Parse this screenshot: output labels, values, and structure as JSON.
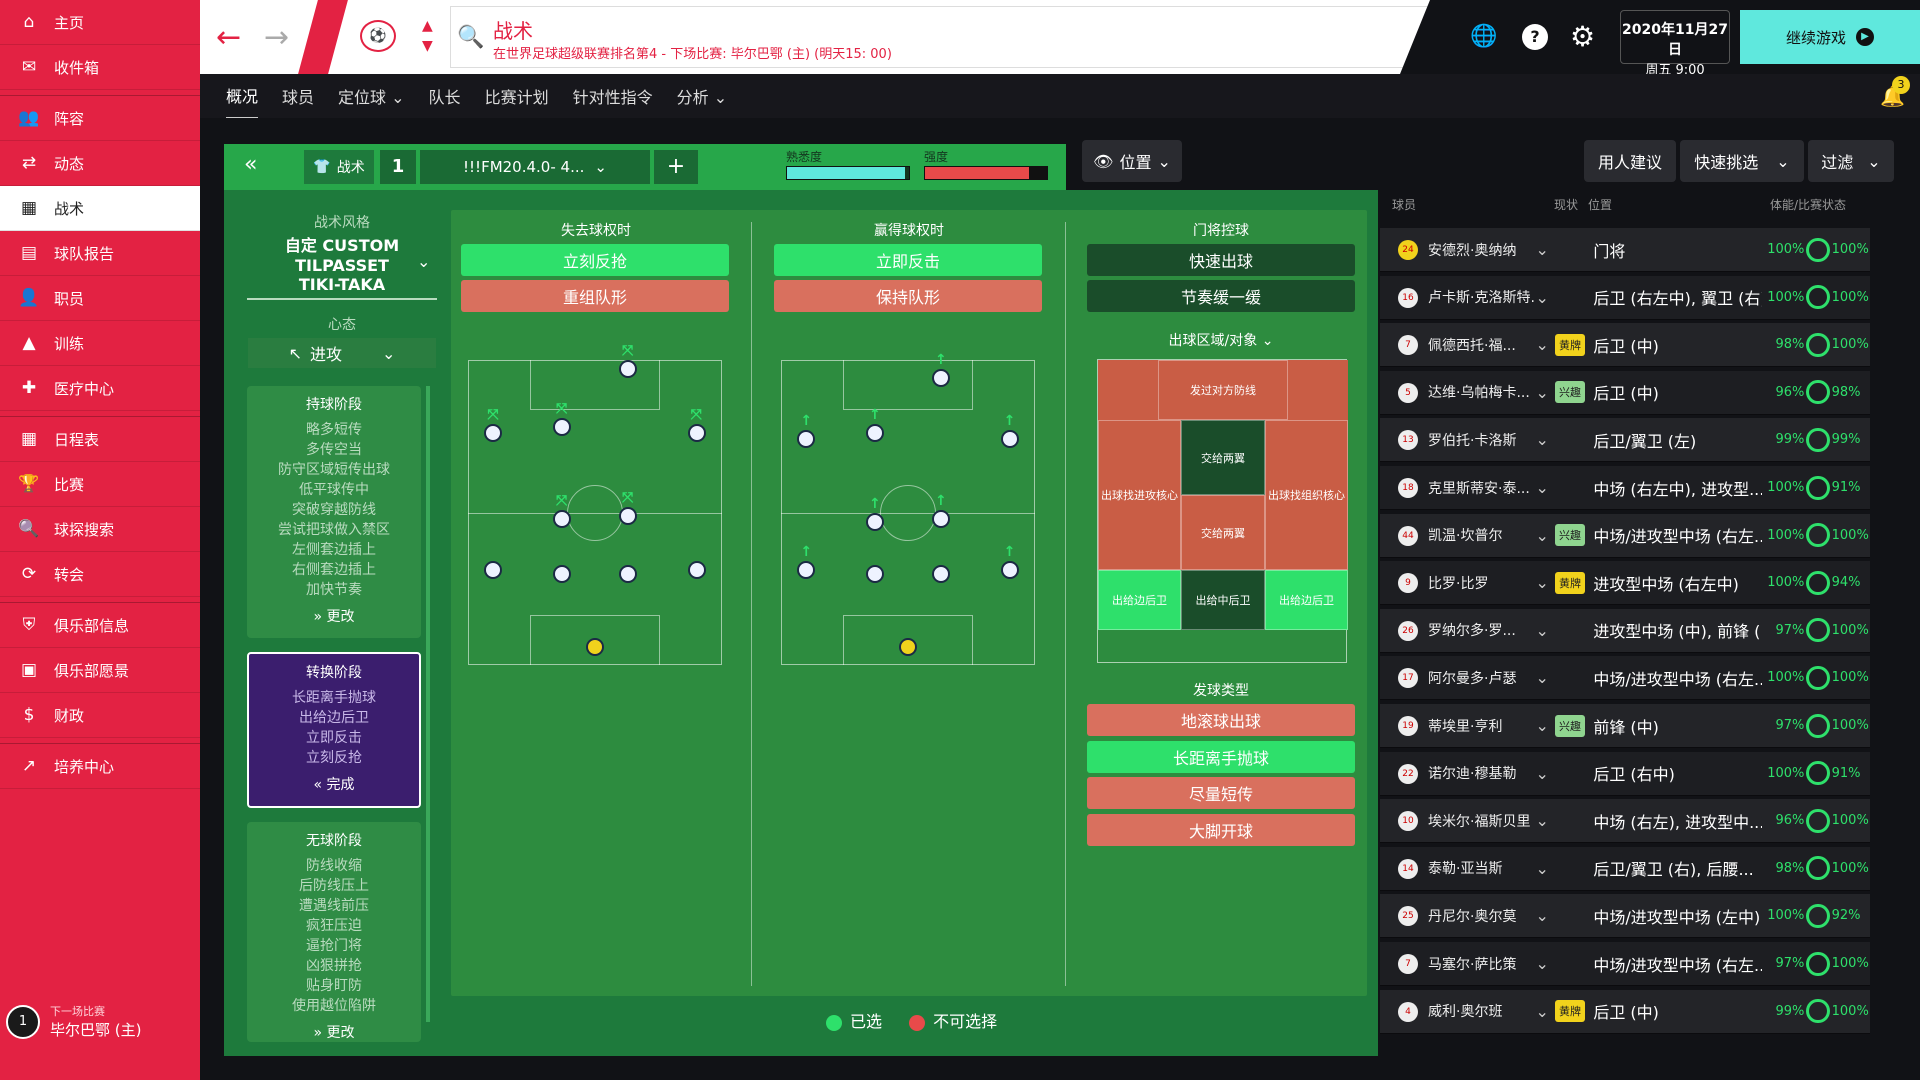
{
  "sidebar": {
    "items": [
      {
        "label": "主页",
        "icon": "home-icon"
      },
      {
        "label": "收件箱",
        "icon": "inbox-icon"
      },
      {
        "label": "阵容",
        "icon": "squad-icon"
      },
      {
        "label": "动态",
        "icon": "dynamics-icon"
      },
      {
        "label": "战术",
        "icon": "tactics-icon",
        "active": true
      },
      {
        "label": "球队报告",
        "icon": "report-icon"
      },
      {
        "label": "职员",
        "icon": "staff-icon"
      },
      {
        "label": "训练",
        "icon": "training-icon"
      },
      {
        "label": "医疗中心",
        "icon": "medical-icon"
      },
      {
        "label": "日程表",
        "icon": "calendar-icon"
      },
      {
        "label": "比赛",
        "icon": "trophy-icon"
      },
      {
        "label": "球探搜索",
        "icon": "search-icon"
      },
      {
        "label": "转会",
        "icon": "transfer-icon"
      },
      {
        "label": "俱乐部信息",
        "icon": "shield-icon"
      },
      {
        "label": "俱乐部愿景",
        "icon": "briefcase-icon"
      },
      {
        "label": "财政",
        "icon": "money-icon"
      },
      {
        "label": "培养中心",
        "icon": "development-icon"
      }
    ],
    "next_match": {
      "caption": "下一场比赛",
      "opponent": "毕尔巴鄂 (主)",
      "num": "1"
    }
  },
  "header": {
    "title": "战术",
    "subtitle": "在世界足球超级联赛排名第4 - 下场比赛: 毕尔巴鄂 (主) (明天15: 00)",
    "date": "2020年11月27日",
    "time": "周五 9:00",
    "continue": "继续游戏",
    "notif_count": "3"
  },
  "subnav": [
    "概况",
    "球员",
    "定位球",
    "队长",
    "比赛计划",
    "针对性指令",
    "分析"
  ],
  "tactic_bar": {
    "label": "战术",
    "slot": "1",
    "name": "!!!FM20.4.0- 4...",
    "familiarity_label": "熟悉度",
    "intensity_label": "强度",
    "familiarity": 0.97,
    "intensity": 0.85,
    "position_btn": "位置"
  },
  "style": {
    "caption": "战术风格",
    "name_l1": "自定 CUSTOM",
    "name_l2": "TILPASSET",
    "name_l3": "TIKI-TAKA",
    "mentality_caption": "心态",
    "mentality": "进攻"
  },
  "phases": [
    {
      "title": "持球阶段",
      "lines": [
        "略多短传",
        "多传空当",
        "防守区域短传出球",
        "低平球传中",
        "突破穿越防线",
        "尝试把球做入禁区",
        "左侧套边插上",
        "右侧套边插上",
        "加快节奏"
      ],
      "action": "更改"
    },
    {
      "title": "转换阶段",
      "lines": [
        "长距离手抛球",
        "出给边后卫",
        "立即反击",
        "立刻反抢"
      ],
      "action": "完成"
    },
    {
      "title": "无球阶段",
      "lines": [
        "防线收缩",
        "后防线压上",
        "遭遇线前压",
        "疯狂压迫",
        "逼抢门将",
        "凶狠拼抢",
        "贴身盯防",
        "使用越位陷阱"
      ],
      "action": "更改"
    }
  ],
  "columns": {
    "lose": {
      "title": "失去球权时",
      "opts": [
        "立刻反抢",
        "重组队形"
      ]
    },
    "win": {
      "title": "赢得球权时",
      "opts": [
        "立即反击",
        "保持队形"
      ]
    },
    "gk": {
      "title": "门将控球",
      "opts": [
        "快速出球",
        "节奏缓一缓"
      ],
      "zones_label": "出球区域/对象",
      "zones": [
        "发过对方防线",
        "出球找进攻核心",
        "交给两翼",
        "出球找组织核心",
        "交给两翼",
        "出给边后卫",
        "出给中后卫",
        "出给边后卫"
      ],
      "dist_label": "发球类型",
      "dist": [
        "地滚球出球",
        "长距离手抛球",
        "尽量短传",
        "大脚开球"
      ]
    }
  },
  "legend": {
    "selected": "已选",
    "unavailable": "不可选择"
  },
  "right": {
    "buttons": [
      "用人建议",
      "快速挑选",
      "过滤"
    ],
    "col_player": "球员",
    "col_status": "现状",
    "col_position": "位置",
    "col_fit": "体能/比赛状态",
    "players": [
      {
        "num": "24",
        "name": "安德烈·奥纳纳",
        "tag": "",
        "pos": "门将",
        "fit": "100%",
        "cond": "100%"
      },
      {
        "num": "16",
        "name": "卢卡斯·克洛斯特...",
        "tag": "",
        "pos": "后卫 (右左中), 翼卫 (右)",
        "fit": "100%",
        "cond": "100%"
      },
      {
        "num": "7",
        "name": "佩德西托·福...",
        "tag": "黄牌",
        "pos": "后卫 (中)",
        "fit": "98%",
        "cond": "100%"
      },
      {
        "num": "5",
        "name": "达维·乌帕梅卡...",
        "tag": "兴趣",
        "pos": "后卫 (中)",
        "fit": "96%",
        "cond": "98%"
      },
      {
        "num": "13",
        "name": "罗伯托·卡洛斯",
        "tag": "",
        "pos": "后卫/翼卫 (左)",
        "fit": "99%",
        "cond": "99%"
      },
      {
        "num": "18",
        "name": "克里斯蒂安·泰...",
        "tag": "",
        "pos": "中场 (右左中), 进攻型...",
        "fit": "100%",
        "cond": "91%"
      },
      {
        "num": "44",
        "name": "凯温·坎普尔",
        "tag": "兴趣",
        "pos": "中场/进攻型中场 (右左...",
        "fit": "100%",
        "cond": "100%"
      },
      {
        "num": "9",
        "name": "比罗·比罗",
        "tag": "黄牌",
        "pos": "进攻型中场 (右左中)",
        "fit": "100%",
        "cond": "94%"
      },
      {
        "num": "26",
        "name": "罗纳尔多·罗...",
        "tag": "",
        "pos": "进攻型中场 (中), 前锋 (...",
        "fit": "97%",
        "cond": "100%"
      },
      {
        "num": "17",
        "name": "阿尔曼多·卢瑟",
        "tag": "",
        "pos": "中场/进攻型中场 (右左...",
        "fit": "100%",
        "cond": "100%"
      },
      {
        "num": "19",
        "name": "蒂埃里·亨利",
        "tag": "兴趣",
        "pos": "前锋 (中)",
        "fit": "97%",
        "cond": "100%"
      },
      {
        "num": "22",
        "name": "诺尔迪·穆基勒",
        "tag": "",
        "pos": "后卫 (右中)",
        "fit": "100%",
        "cond": "91%"
      },
      {
        "num": "10",
        "name": "埃米尔·福斯贝里",
        "tag": "",
        "pos": "中场 (右左), 进攻型中...",
        "fit": "96%",
        "cond": "100%"
      },
      {
        "num": "14",
        "name": "泰勒·亚当斯",
        "tag": "",
        "pos": "后卫/翼卫 (右), 后腰...",
        "fit": "98%",
        "cond": "100%"
      },
      {
        "num": "25",
        "name": "丹尼尔·奥尔莫",
        "tag": "",
        "pos": "中场/进攻型中场 (左中)",
        "fit": "100%",
        "cond": "92%"
      },
      {
        "num": "7",
        "name": "马塞尔·萨比策",
        "tag": "",
        "pos": "中场/进攻型中场 (右左...",
        "fit": "97%",
        "cond": "100%"
      },
      {
        "num": "4",
        "name": "威利·奥尔班",
        "tag": "黄牌",
        "pos": "后卫 (中)",
        "fit": "99%",
        "cond": "100%"
      }
    ]
  },
  "colors": {
    "brand": "#e32243",
    "selected": "#2ee06b",
    "unavailable": "#d9705e",
    "panel": "#1e7a3c"
  }
}
